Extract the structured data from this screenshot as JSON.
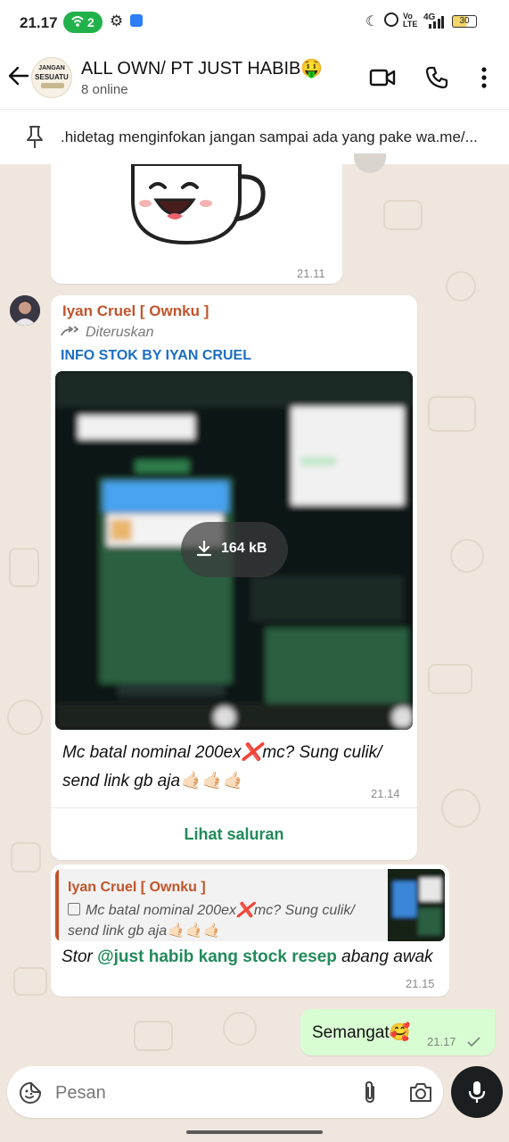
{
  "status_bar": {
    "time": "21.17",
    "hotspot_count": "2",
    "network": "4G",
    "volte": "Vo\nLTE",
    "battery": "30"
  },
  "header": {
    "title": "ALL OWN/ PT JUST HABIB🤑",
    "subtitle": "8 online",
    "avatar_text_top": "JANGAN",
    "avatar_text_mid": "SESUATU"
  },
  "pinned": {
    "text": ".hidetag menginfokan jangan sampai ada yang pake wa.me/..."
  },
  "messages": {
    "sticker": {
      "time": "21.11"
    },
    "forwarded": {
      "sender": "Iyan Cruel [ Ownku ]",
      "forwarded_label": "Diteruskan",
      "channel_name": "INFO STOK BY IYAN CRUEL",
      "download_size": "164 kB",
      "caption_line1": "Mc batal nominal 200ex❌mc? Sung culik/",
      "caption_line2": "send link gb aja🤙🏻🤙🏻🤙🏻",
      "time": "21.14",
      "view_channel": "Lihat saluran"
    },
    "reply": {
      "quoted_sender": "Iyan Cruel [ Ownku ]",
      "quoted_line1": "Mc batal nominal 200ex❌mc? Sung culik/",
      "quoted_line2": "send link gb aja🤙🏻🤙🏻🤙🏻",
      "text_before": "Stor ",
      "mention": "@just habib kang stock resep",
      "text_after": " abang awak",
      "time": "21.15"
    },
    "outgoing": {
      "text": "Semangat🥰",
      "time": "21.17"
    }
  },
  "composer": {
    "placeholder": "Pesan"
  },
  "colors": {
    "sender_name": "#c2542b",
    "channel_name": "#1b6ec2",
    "accent_green": "#218a5a",
    "outgoing_bubble": "#d9fdd3",
    "chat_background": "#efe7de"
  }
}
